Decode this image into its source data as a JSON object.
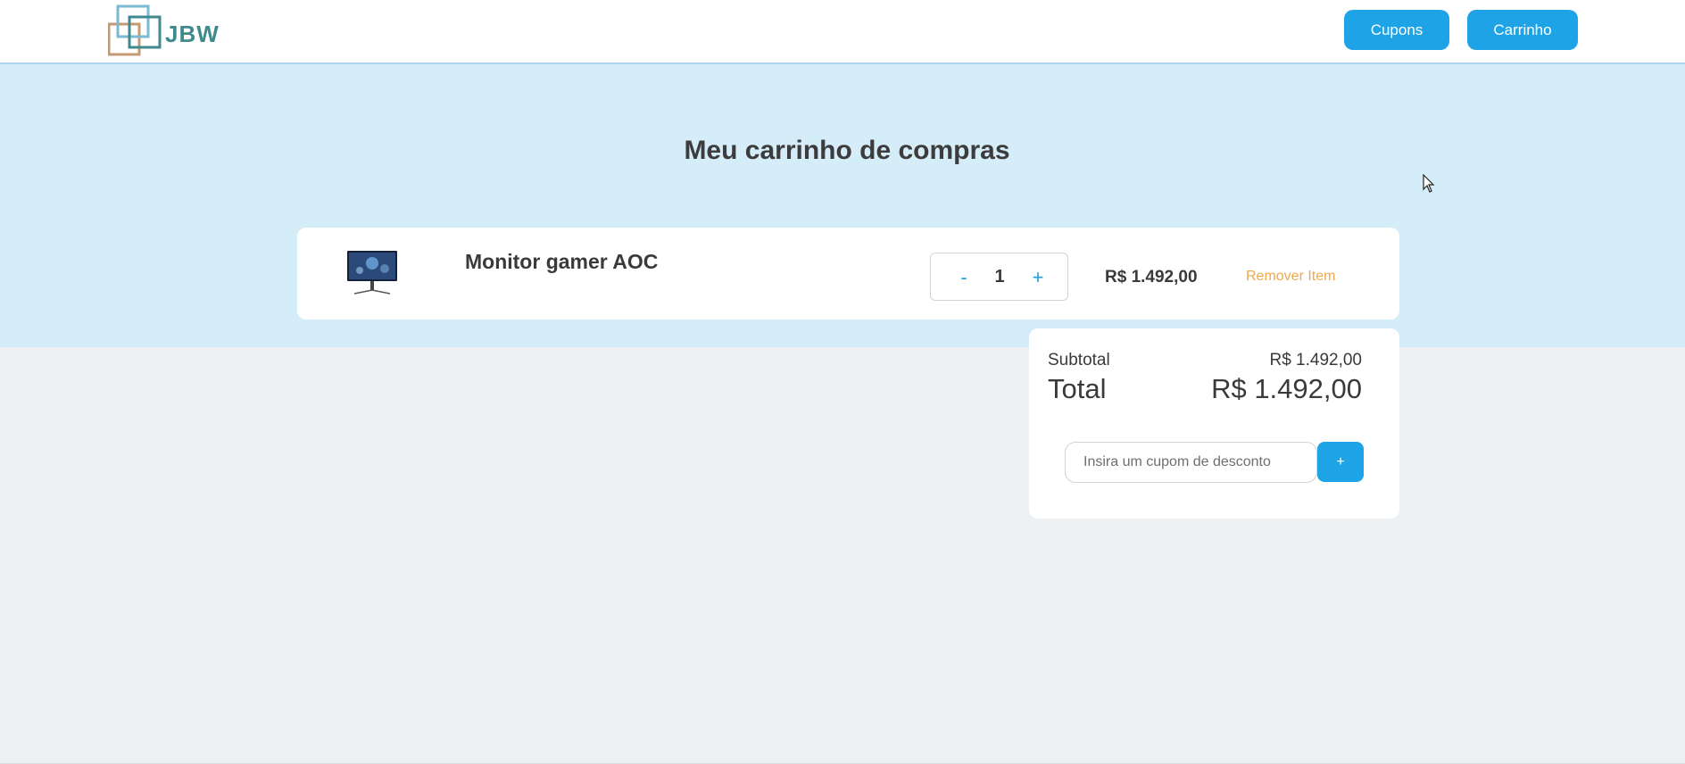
{
  "header": {
    "logo_text": "JBW",
    "nav": {
      "cupons_label": "Cupons",
      "carrinho_label": "Carrinho"
    }
  },
  "page": {
    "title": "Meu carrinho de compras"
  },
  "cart": {
    "items": [
      {
        "name": "Monitor gamer AOC",
        "quantity": "1",
        "decrement_label": "-",
        "increment_label": "+",
        "price": "R$ 1.492,00",
        "remove_label": "Remover Item"
      }
    ]
  },
  "summary": {
    "subtotal_label": "Subtotal",
    "subtotal_value": "R$ 1.492,00",
    "total_label": "Total",
    "total_value": "R$ 1.492,00",
    "coupon_placeholder": "Insira um cupom de desconto",
    "coupon_add_label": "+"
  },
  "colors": {
    "accent": "#1ea4e6",
    "band_background": "#d5ecf9",
    "page_background": "#edf1f4",
    "remove_link": "#f0a94a",
    "logo_teal": "#3f8a8c",
    "logo_brown": "#c49a72"
  }
}
